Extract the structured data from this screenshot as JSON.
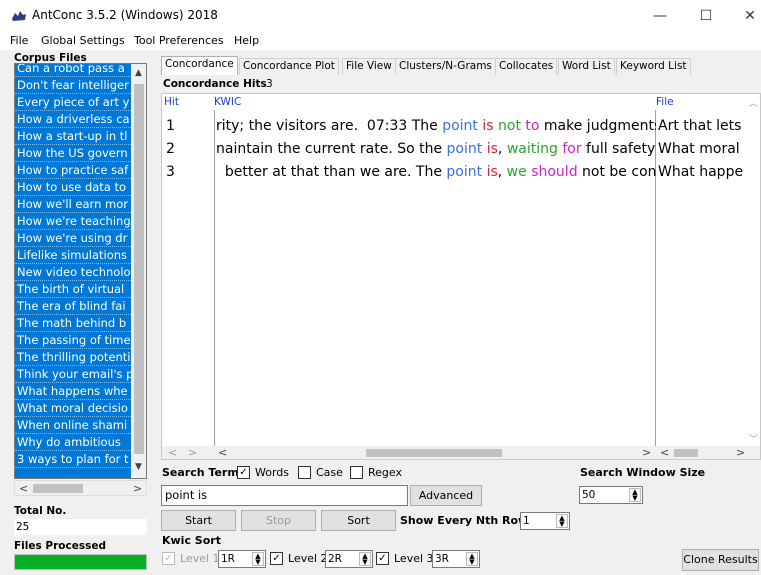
{
  "window": {
    "title": "AntConc 3.5.2 (Windows) 2018",
    "minimize": "—",
    "maximize": "☐",
    "close": "✕"
  },
  "menu": [
    "File",
    "Global Settings",
    "Tool Preferences",
    "Help"
  ],
  "corpus": {
    "label": "Corpus Files",
    "items": [
      "Can a robot pass a",
      "Don't fear intelliger",
      "Every piece of art y",
      "How a driverless ca",
      "How a start-up in tl",
      "How the US govern",
      "How to practice saf",
      "How to use data to",
      "How we'll earn mor",
      "How we're teaching",
      "How we're using dr",
      "Lifelike simulations",
      "New video technolo",
      "The birth of virtual",
      "The era of blind fai",
      "The math behind b",
      "The passing of time",
      "The thrilling potenti",
      "Think your email's p",
      "What happens whe",
      "What moral decisio",
      "When online shami",
      "Why do ambitious",
      "3 ways to plan for t"
    ],
    "total_label": "Total No.",
    "total_value": "25",
    "files_processed_label": "Files Processed",
    "progress": 1.0
  },
  "tabs": [
    "Concordance",
    "Concordance Plot",
    "File View",
    "Clusters/N-Grams",
    "Collocates",
    "Word List",
    "Keyword List"
  ],
  "concordance": {
    "hits_label": "Concordance Hits",
    "hits_count": "3",
    "columns": {
      "hit": "Hit",
      "kwic": "KWIC",
      "file": "File"
    },
    "rows": [
      {
        "hit": "1",
        "segments": [
          {
            "text": "rity; the visitors are.  07:33 The ",
            "color": "#000000"
          },
          {
            "text": "point",
            "color": "#3b6fe0"
          },
          {
            "text": " ",
            "color": "#000000"
          },
          {
            "text": "is",
            "color": "#e0203a"
          },
          {
            "text": " ",
            "color": "#000000"
          },
          {
            "text": "not",
            "color": "#2aa52a"
          },
          {
            "text": " ",
            "color": "#000000"
          },
          {
            "text": "to",
            "color": "#cc22cc"
          },
          {
            "text": " make judgments,",
            "color": "#000000"
          }
        ],
        "file": "Art that lets y"
      },
      {
        "hit": "2",
        "segments": [
          {
            "text": "naintain the current rate. So the ",
            "color": "#000000"
          },
          {
            "text": "point",
            "color": "#3b6fe0"
          },
          {
            "text": " ",
            "color": "#000000"
          },
          {
            "text": "is",
            "color": "#e0203a"
          },
          {
            "text": ", ",
            "color": "#000000"
          },
          {
            "text": "waiting",
            "color": "#2aa52a"
          },
          {
            "text": " ",
            "color": "#000000"
          },
          {
            "text": "for",
            "color": "#cc22cc"
          },
          {
            "text": " full safety is",
            "color": "#000000"
          }
        ],
        "file": "What moral"
      },
      {
        "hit": "3",
        "segments": [
          {
            "text": "  better at that than we are. The ",
            "color": "#000000"
          },
          {
            "text": "point",
            "color": "#3b6fe0"
          },
          {
            "text": " ",
            "color": "#000000"
          },
          {
            "text": "is",
            "color": "#e0203a"
          },
          {
            "text": ", ",
            "color": "#000000"
          },
          {
            "text": "we",
            "color": "#2aa52a"
          },
          {
            "text": " ",
            "color": "#000000"
          },
          {
            "text": "should",
            "color": "#cc22cc"
          },
          {
            "text": " not be confic",
            "color": "#000000"
          }
        ],
        "file": "What happen"
      }
    ]
  },
  "search": {
    "term_label": "Search Term",
    "words_label": "Words",
    "words_checked": true,
    "case_label": "Case",
    "case_checked": false,
    "regex_label": "Regex",
    "regex_checked": false,
    "term_value": "point is",
    "advanced_label": "Advanced",
    "window_size_label": "Search Window Size",
    "window_size_value": "50",
    "start_label": "Start",
    "stop_label": "Stop",
    "sort_label": "Sort",
    "nth_row_label": "Show Every Nth Row",
    "nth_row_value": "1"
  },
  "kwic_sort": {
    "label": "Kwic Sort",
    "level1_label": "Level 1",
    "level1_value": "1R",
    "level2_label": "Level 2",
    "level2_value": "2R",
    "level3_label": "Level 3",
    "level3_value": "3R",
    "clone_label": "Clone Results"
  }
}
